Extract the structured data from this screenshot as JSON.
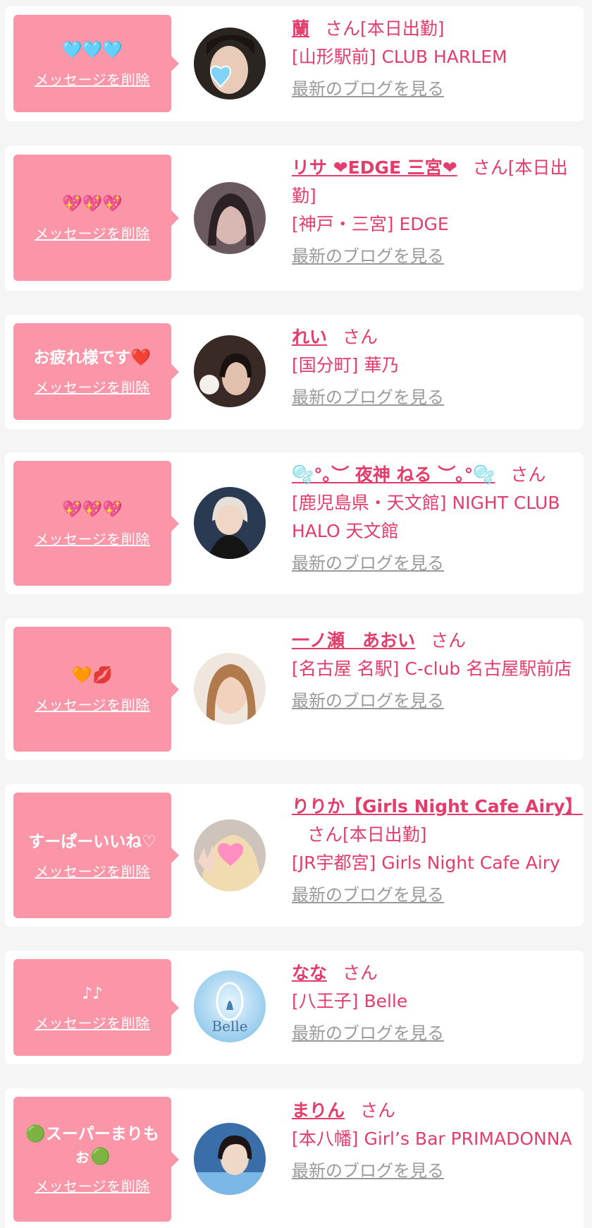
{
  "delete_label": "メッセージを削除",
  "blog_label": "最新のブログを見る",
  "san_label": "さん",
  "colors": {
    "bubble": "#fb95a8",
    "accent": "#e23d6b",
    "link_gray": "#9a9a9a",
    "page_bg": "#f5f5f5"
  },
  "items": [
    {
      "message": "🩵🩵🩵",
      "name": "蘭",
      "suffix": "[本日出勤]",
      "shop": "[山形駅前] CLUB HARLEM",
      "avatar_icon": "woman-portrait-heart-sticker-icon"
    },
    {
      "message": "💖💖💖",
      "name": "リサ ❤EDGE 三宮❤",
      "suffix": "[本日出勤]",
      "shop": "[神戸・三宮] EDGE",
      "avatar_icon": "woman-portrait-icon"
    },
    {
      "message": "お疲れ様です❤️",
      "name": "れい",
      "suffix": "",
      "shop": "[国分町] 華乃",
      "avatar_icon": "woman-portrait-icon"
    },
    {
      "message": "💖💖💖",
      "name": "🫧°｡︶ 夜神 ねる ︶｡°🫧",
      "suffix": "",
      "shop": "[鹿児島県・天文館] NIGHT CLUB HALO 天文館",
      "avatar_icon": "woman-portrait-icon"
    },
    {
      "message": "🧡💋",
      "name": "一ノ瀬　あおい",
      "suffix": "",
      "shop": "[名古屋 名駅] C-club 名古屋駅前店",
      "avatar_icon": "woman-portrait-icon"
    },
    {
      "message": "すーぱーいいね♡",
      "name": "りりか【Girls Night Cafe Airy】",
      "suffix": "[本日出勤]",
      "shop": "[JR宇都宮] Girls Night Cafe Airy",
      "avatar_icon": "woman-portrait-heart-sticker-icon"
    },
    {
      "message": "♪♪",
      "name": "なな",
      "suffix": "",
      "shop": "[八王子] Belle",
      "avatar_icon": "belle-logo-icon",
      "avatar_logo_text": "Belle"
    },
    {
      "message": "🟢スーパーまりもぉ🟢",
      "name": "まりん",
      "suffix": "",
      "shop": "[本八幡] Girl’s Bar PRIMADONNA",
      "avatar_icon": "woman-portrait-icon"
    }
  ]
}
